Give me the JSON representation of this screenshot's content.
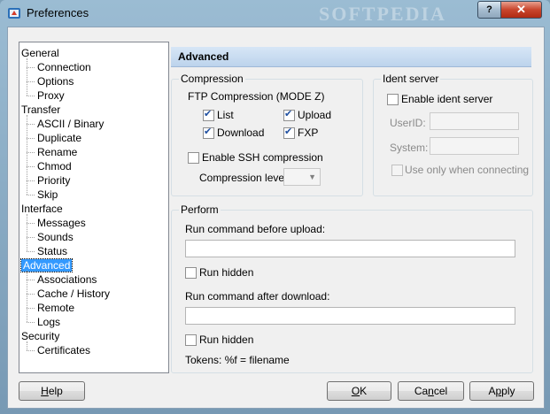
{
  "window": {
    "title": "Preferences",
    "watermark": "SOFTPEDIA",
    "help_glyph": "?",
    "close_glyph": "✕"
  },
  "tree": {
    "items": [
      {
        "label": "General",
        "level": 0
      },
      {
        "label": "Connection",
        "level": 1
      },
      {
        "label": "Options",
        "level": 1
      },
      {
        "label": "Proxy",
        "level": 1
      },
      {
        "label": "Transfer",
        "level": 0
      },
      {
        "label": "ASCII / Binary",
        "level": 1
      },
      {
        "label": "Duplicate",
        "level": 1
      },
      {
        "label": "Rename",
        "level": 1
      },
      {
        "label": "Chmod",
        "level": 1
      },
      {
        "label": "Priority",
        "level": 1
      },
      {
        "label": "Skip",
        "level": 1
      },
      {
        "label": "Interface",
        "level": 0
      },
      {
        "label": "Messages",
        "level": 1
      },
      {
        "label": "Sounds",
        "level": 1
      },
      {
        "label": "Status",
        "level": 1
      },
      {
        "label": "Advanced",
        "level": 0,
        "selected": true
      },
      {
        "label": "Associations",
        "level": 1
      },
      {
        "label": "Cache / History",
        "level": 1
      },
      {
        "label": "Remote",
        "level": 1
      },
      {
        "label": "Logs",
        "level": 1
      },
      {
        "label": "Security",
        "level": 0
      },
      {
        "label": "Certificates",
        "level": 1
      }
    ]
  },
  "panel": {
    "title": "Advanced",
    "compression": {
      "group_label": "Compression",
      "ftp_label": "FTP Compression (MODE Z)",
      "list": {
        "label": "List",
        "checked": true
      },
      "upload": {
        "label": "Upload",
        "checked": true
      },
      "download": {
        "label": "Download",
        "checked": true
      },
      "fxp": {
        "label": "FXP",
        "checked": true
      },
      "ssh": {
        "label": "Enable SSH compression",
        "checked": false
      },
      "level_label": "Compression level:",
      "level_value": ""
    },
    "ident": {
      "group_label": "Ident server",
      "enable": {
        "label": "Enable ident server",
        "checked": false
      },
      "userid_label": "UserID:",
      "userid_value": "",
      "system_label": "System:",
      "system_value": "",
      "only_connecting": {
        "label": "Use only when connecting",
        "checked": false
      }
    },
    "perform": {
      "group_label": "Perform",
      "before_label": "Run command before upload:",
      "before_value": "",
      "hidden1": {
        "label": "Run hidden",
        "checked": false
      },
      "after_label": "Run command after download:",
      "after_value": "",
      "hidden2": {
        "label": "Run hidden",
        "checked": false
      },
      "tokens": "Tokens:  %f = filename"
    }
  },
  "buttons": {
    "help_ul": "H",
    "help_rest": "elp",
    "ok_ul": "O",
    "ok_rest": "K",
    "cancel_pre": "Ca",
    "cancel_ul": "n",
    "cancel_rest": "cel",
    "apply_pre": "A",
    "apply_ul": "p",
    "apply_rest": "ply"
  },
  "colors": {
    "selection": "#3399ff",
    "header": "#bcd3ec",
    "check": "#1f4fa0"
  }
}
